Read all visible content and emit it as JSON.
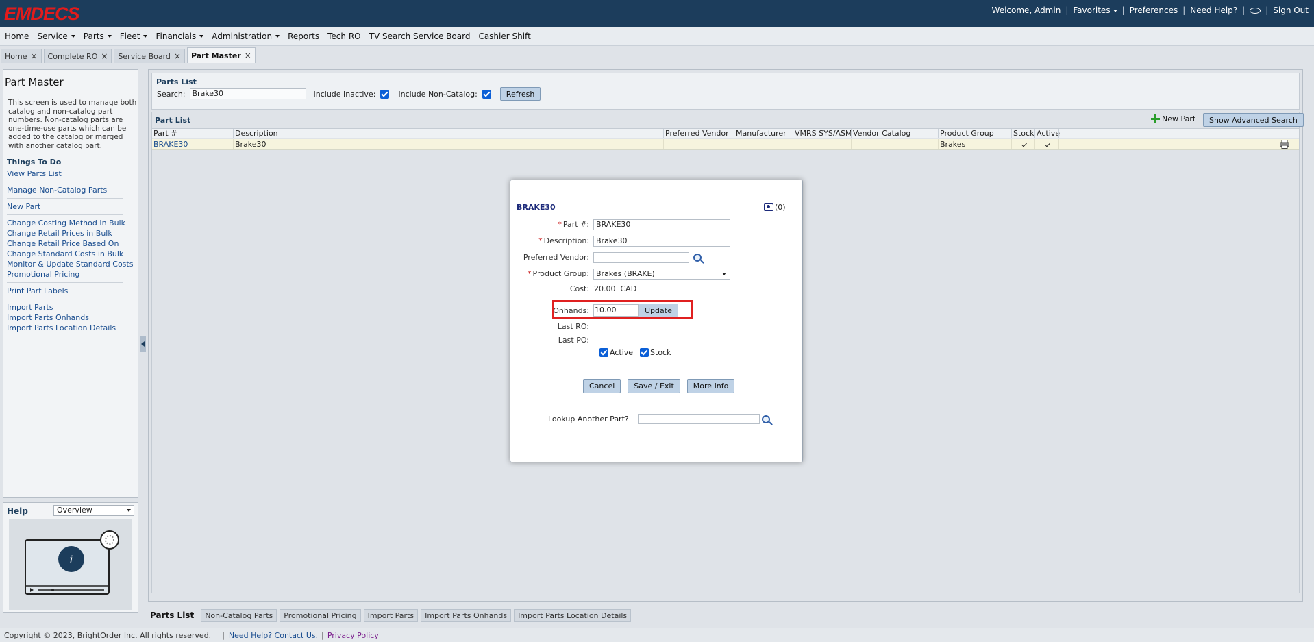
{
  "app": {
    "logo": "EMDECS",
    "welcome": "Welcome, Admin",
    "favorites": "Favorites",
    "preferences": "Preferences",
    "need_help": "Need Help?",
    "sign_out": "Sign Out"
  },
  "nav": [
    "Home",
    "Service",
    "Parts",
    "Fleet",
    "Financials",
    "Administration",
    "Reports",
    "Tech RO",
    "TV Search Service Board",
    "Cashier Shift"
  ],
  "nav_dropdowns": [
    false,
    true,
    true,
    true,
    true,
    true,
    false,
    false,
    false,
    false
  ],
  "tabs": [
    {
      "label": "Home"
    },
    {
      "label": "Complete RO"
    },
    {
      "label": "Service Board"
    },
    {
      "label": "Part Master",
      "active": true
    }
  ],
  "left": {
    "title": "Part Master",
    "description": "This screen is used to manage both catalog and non-catalog part numbers. Non-catalog parts are one-time-use parts which can be added to the catalog or merged with another catalog part.",
    "todo_title": "Things To Do",
    "todo_groups": [
      [
        "View Parts List"
      ],
      [
        "Manage Non-Catalog Parts"
      ],
      [
        "New Part"
      ],
      [
        "Change Costing Method In Bulk",
        "Change Retail Prices in Bulk",
        "Change Retail Price Based On",
        "Change Standard Costs in Bulk",
        "Monitor & Update Standard Costs",
        "Promotional Pricing"
      ],
      [
        "Print Part Labels"
      ],
      [
        "Import Parts",
        "Import Parts Onhands",
        "Import Parts Location Details"
      ]
    ],
    "help_title": "Help",
    "help_select": "Overview"
  },
  "parts_list": {
    "title": "Parts List",
    "search_label": "Search:",
    "search_value": "Brake30",
    "include_inactive": "Include Inactive:",
    "include_noncatalog": "Include Non-Catalog:",
    "refresh": "Refresh"
  },
  "grid": {
    "title": "Part List",
    "new_part": "New Part",
    "advanced_search": "Show Advanced Search",
    "columns": [
      "Part #",
      "Description",
      "Preferred Vendor",
      "Manufacturer",
      "VMRS SYS/ASM",
      "Vendor Catalog",
      "Product Group",
      "Stock",
      "Active"
    ],
    "rows": [
      {
        "part": "BRAKE30",
        "description": "Brake30",
        "preferred_vendor": "",
        "manufacturer": "",
        "vmrs": "",
        "vendor_catalog": "",
        "product_group": "Brakes",
        "stock": true,
        "active": true
      }
    ]
  },
  "bottom_tabs": [
    "Parts List",
    "Non-Catalog Parts",
    "Promotional Pricing",
    "Import Parts",
    "Import Parts Onhands",
    "Import Parts Location Details"
  ],
  "footer": {
    "copyright": "Copyright © 2023, BrightOrder Inc. All rights reserved.",
    "contact": "Need Help? Contact Us.",
    "privacy": "Privacy Policy"
  },
  "modal": {
    "title": "BRAKE30",
    "photo_count": "(0)",
    "part_label": "Part #:",
    "part_value": "BRAKE30",
    "desc_label": "Description:",
    "desc_value": "Brake30",
    "vendor_label": "Preferred Vendor:",
    "vendor_value": "",
    "group_label": "Product Group:",
    "group_value": "Brakes (BRAKE)",
    "cost_label": "Cost:",
    "cost_value": "20.00  CAD",
    "onhands_label": "Onhands:",
    "onhands_value": "10.00",
    "update": "Update",
    "last_ro_label": "Last RO:",
    "last_po_label": "Last PO:",
    "active_label": "Active",
    "stock_label": "Stock",
    "cancel": "Cancel",
    "save_exit": "Save / Exit",
    "more_info": "More Info",
    "lookup_label": "Lookup Another Part?"
  },
  "colors": {
    "header_bg": "#1c3d5c",
    "logo_red": "#e21b1b",
    "highlight_red": "#e02020",
    "checkbox_blue": "#0b5fd7"
  }
}
